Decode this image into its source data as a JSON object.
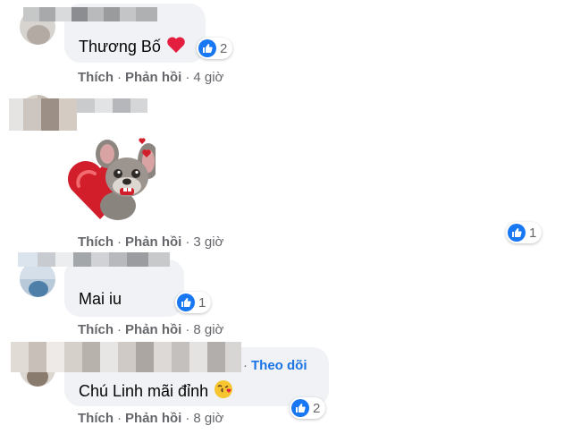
{
  "comments": [
    {
      "text": "Thương Bố",
      "emoji": "heart-emoji",
      "likes": "2",
      "actions": {
        "like": "Thích",
        "reply": "Phản hồi",
        "dot": "·",
        "time": "4 giờ"
      }
    },
    {
      "sticker": "mouse-with-heart-sticker",
      "likes": "1",
      "actions": {
        "like": "Thích",
        "reply": "Phản hồi",
        "dot": "·",
        "time": "3 giờ"
      }
    },
    {
      "text": "Mai iu",
      "likes": "1",
      "actions": {
        "like": "Thích",
        "reply": "Phản hồi",
        "dot": "·",
        "time": "8 giờ"
      }
    },
    {
      "text": "Chú Linh mãi đỉnh",
      "emoji": "kissing-face-emoji",
      "follow": "Theo dõi",
      "follow_sep": "·",
      "likes": "2",
      "actions": {
        "like": "Thích",
        "reply": "Phản hồi",
        "dot": "·",
        "time": "8 giờ"
      }
    }
  ],
  "colors": {
    "like_blue": "#1877f2",
    "bubble": "#f0f2f5",
    "meta_gray": "#65676b",
    "follow_blue": "#1b74e4"
  }
}
